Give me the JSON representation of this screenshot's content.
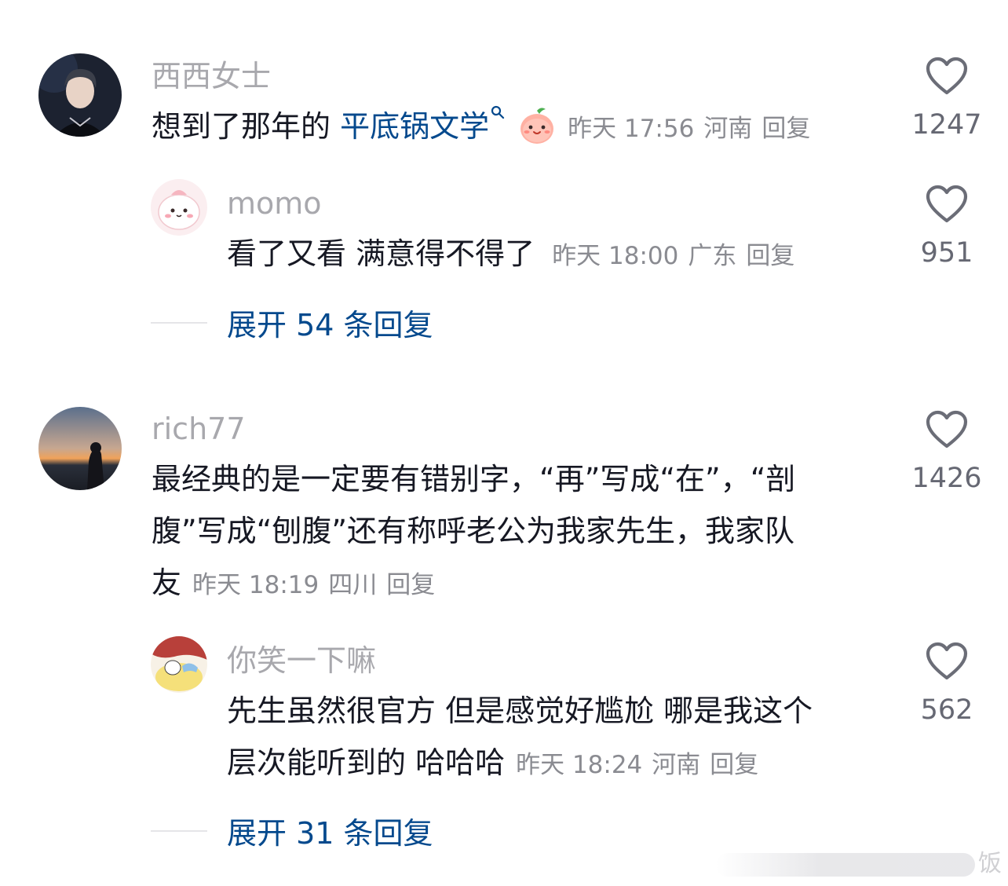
{
  "comments": [
    {
      "username": "西西女士",
      "text_before": "想到了那年的",
      "hashtag": "平底锅文学",
      "emoji": "peach-face-emoji",
      "time": "昨天 17:56",
      "location": "河南",
      "reply_label": "回复",
      "likes": "1247",
      "replies": [
        {
          "username": "momo",
          "text": "看了又看 满意得不得了",
          "time": "昨天 18:00",
          "location": "广东",
          "reply_label": "回复",
          "likes": "951"
        }
      ],
      "expand_label": "展开 54 条回复"
    },
    {
      "username": "rich77",
      "lines": [
        "最经典的是一定要有错别字，“再”写成“在”，“剖",
        "腹”写成“刨腹”还有称呼老公为我家先生，我家队",
        "友"
      ],
      "time": "昨天 18:19",
      "location": "四川",
      "reply_label": "回复",
      "likes": "1426",
      "replies": [
        {
          "username": "你笑一下嘛",
          "lines": [
            "先生虽然很官方 但是感觉好尴尬 哪是我这个",
            "层次能听到的 哈哈哈"
          ],
          "time": "昨天 18:24",
          "location": "河南",
          "reply_label": "回复",
          "likes": "562"
        }
      ],
      "expand_label": "展开 31 条回复"
    }
  ],
  "watermark": "饭",
  "colors": {
    "link": "#04498d",
    "meta": "#8a8b91",
    "username": "#a8a8ad",
    "text": "#161823"
  }
}
